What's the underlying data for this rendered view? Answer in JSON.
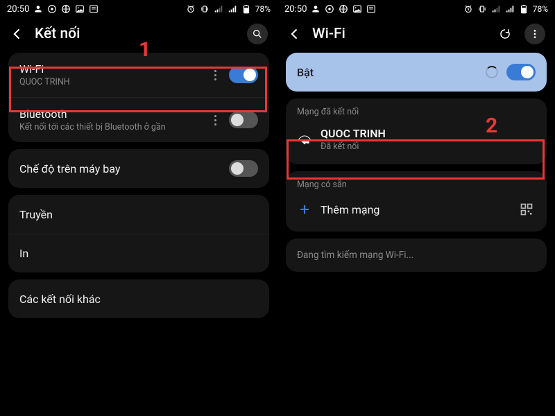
{
  "status": {
    "time": "20:50",
    "battery": "78%"
  },
  "left": {
    "header_title": "Kết nối",
    "wifi": {
      "title": "Wi-Fi",
      "sub": "QUOC TRINH"
    },
    "bluetooth": {
      "title": "Bluetooth",
      "sub": "Kết nối tới các thiết bị Bluetooth ở gần"
    },
    "airplane": {
      "title": "Chế độ trên máy bay"
    },
    "cast": {
      "title": "Truyền"
    },
    "print": {
      "title": "In"
    },
    "more": {
      "title": "Các kết nối khác"
    },
    "annotation": "1"
  },
  "right": {
    "header_title": "Wi-Fi",
    "on_label": "Bật",
    "section_connected": "Mạng đã kết nối",
    "connected": {
      "ssid": "QUOC TRINH",
      "status": "Đã kết nối"
    },
    "section_available": "Mạng có sẵn",
    "add_network": "Thêm mạng",
    "searching": "Đang tìm kiếm mạng Wi-Fi...",
    "annotation": "2"
  }
}
